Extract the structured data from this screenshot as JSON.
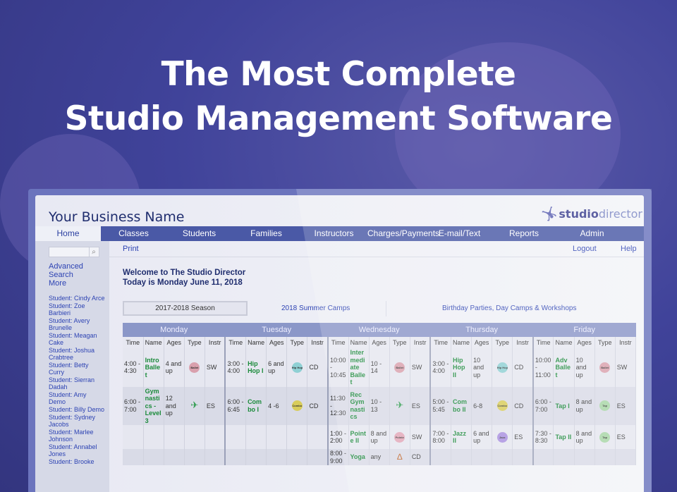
{
  "headline": {
    "line1": "The Most Complete",
    "line2": "Studio Management Software"
  },
  "app": {
    "business_name": "Your Business Name",
    "logo_text_bold": "studio",
    "logo_text_light": "director"
  },
  "nav": [
    {
      "label": "Home",
      "active": true
    },
    {
      "label": "Classes"
    },
    {
      "label": "Students"
    },
    {
      "label": "Families"
    },
    {
      "label": "Instructors"
    },
    {
      "label": "Charges/Payments"
    },
    {
      "label": "E-mail/Text"
    },
    {
      "label": "Reports"
    },
    {
      "label": "Admin"
    }
  ],
  "subnav": {
    "print": "Print",
    "logout": "Logout",
    "help": "Help"
  },
  "sidebar": {
    "search_placeholder": "",
    "search_icon": "magnifier",
    "advanced": "Advanced",
    "search": "Search",
    "more": "More",
    "students": [
      "Student: Cindy Arce",
      "Student: Zoe Barbieri",
      "Student: Avery Brunelle",
      "Student: Meagan Cake",
      "Student: Joshua Crabtree",
      "Student: Betty Curry",
      "Student: Sierran Dadah",
      "Student: Amy Demo",
      "Student: Billy Demo",
      "Student: Sydney Jacobs",
      "Student: Marlee Johnson",
      "Student: Annabel Jones",
      "Student: Brooke"
    ]
  },
  "welcome": {
    "line1": "Welcome to The Studio Director",
    "line2": "Today is Monday June 11, 2018"
  },
  "season_tabs": {
    "active": "2017-2018 Season",
    "summer": "2018 Summer Camps",
    "parties": "Birthday Parties, Day Camps & Workshops"
  },
  "schedule": {
    "columns": [
      "Time",
      "Name",
      "Ages",
      "Type",
      "Instr"
    ],
    "type_colors": {
      "Ballet": "#d9a0ad",
      "Hip Hop": "#8fd0d4",
      "Combo": "#d8cc5a",
      "Pointe": "#e2a6b8",
      "Jazz": "#a98fe0",
      "Tap": "#a8d6a6"
    },
    "days": [
      {
        "day": "Monday",
        "classes": [
          {
            "time": "4:00 - 4:30",
            "name": "Intro Ballet",
            "ages": "4 and up",
            "type": "Ballet",
            "instr": "SW"
          },
          {
            "time": "6:00 - 7:00",
            "name": "Gymnastics - Level 3",
            "ages": "12 and up",
            "type": "Gymnastics",
            "instr": "ES"
          }
        ]
      },
      {
        "day": "Tuesday",
        "classes": [
          {
            "time": "3:00 - 4:00",
            "name": "Hip Hop I",
            "ages": "6 and up",
            "type": "Hip Hop",
            "instr": "CD"
          },
          {
            "time": "6:00 - 6:45",
            "name": "Combo I",
            "ages": "4 -6",
            "type": "Combo",
            "instr": "CD"
          }
        ]
      },
      {
        "day": "Wednesday",
        "classes": [
          {
            "time": "10:00 - 10:45",
            "name": "Intermediate Ballet",
            "ages": "10 - 14",
            "type": "Ballet",
            "instr": "SW"
          },
          {
            "time": "11:30 - 12:30",
            "name": "Rec Gymnastics",
            "ages": "10 - 13",
            "type": "Gymnastics",
            "instr": "ES"
          },
          {
            "time": "1:00 - 2:00",
            "name": "Pointe II",
            "ages": "8 and up",
            "type": "Pointe",
            "instr": "SW"
          },
          {
            "time": "8:00 - 9:00",
            "name": "Yoga",
            "ages": "any",
            "type": "Yoga",
            "instr": "CD"
          }
        ]
      },
      {
        "day": "Thursday",
        "classes": [
          {
            "time": "3:00 - 4:00",
            "name": "Hip Hop II",
            "ages": "10 and up",
            "type": "Hip Hop",
            "instr": "CD"
          },
          {
            "time": "5:00 - 5:45",
            "name": "Combo II",
            "ages": "6-8",
            "type": "Combo",
            "instr": "CD"
          },
          {
            "time": "7:00 - 8:00",
            "name": "Jazz II",
            "ages": "6 and up",
            "type": "Jazz",
            "instr": "ES"
          }
        ]
      },
      {
        "day": "Friday",
        "classes": [
          {
            "time": "10:00 - 11:00",
            "name": "Adv Ballet",
            "ages": "10 and up",
            "type": "Ballet",
            "instr": "SW"
          },
          {
            "time": "6:00 - 7:00",
            "name": "Tap I",
            "ages": "8 and up",
            "type": "Tap",
            "instr": "ES"
          },
          {
            "time": "7:30 - 8:30",
            "name": "Tap II",
            "ages": "8 and up",
            "type": "Tap",
            "instr": "ES"
          }
        ]
      }
    ]
  }
}
